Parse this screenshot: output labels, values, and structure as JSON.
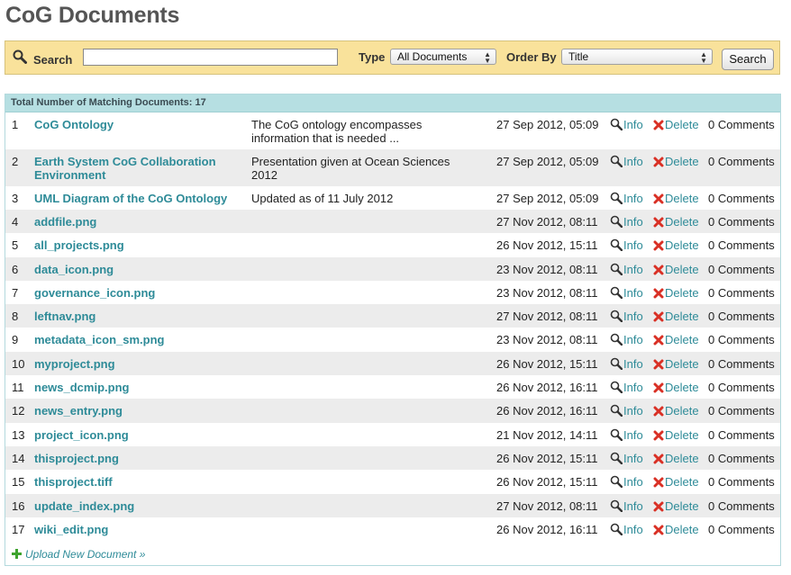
{
  "page": {
    "title": "CoG Documents"
  },
  "search": {
    "label": "Search",
    "value": "",
    "type_label": "Type",
    "type_selected": "All Documents",
    "order_label": "Order By",
    "order_selected": "Title",
    "button_label": "Search"
  },
  "results": {
    "summary": "Total Number of Matching Documents: 17",
    "rows": [
      {
        "num": "1",
        "title": [
          "CoG Ontology"
        ],
        "desc": [
          "The CoG ontology encompasses",
          "information that is needed ..."
        ],
        "date": "27 Sep 2012, 05:09",
        "info": "Info",
        "delete": "Delete",
        "comments": "0 Comments"
      },
      {
        "num": "2",
        "title": [
          "Earth System CoG Collaboration",
          "Environment"
        ],
        "desc": [
          "Presentation given at Ocean Sciences",
          "2012"
        ],
        "date": "27 Sep 2012, 05:09",
        "info": "Info",
        "delete": "Delete",
        "comments": "0 Comments"
      },
      {
        "num": "3",
        "title": [
          "UML Diagram of the CoG Ontology"
        ],
        "desc": [
          "Updated as of 11 July 2012"
        ],
        "date": "27 Sep 2012, 05:09",
        "info": "Info",
        "delete": "Delete",
        "comments": "0 Comments"
      },
      {
        "num": "4",
        "title": [
          "addfile.png"
        ],
        "desc": [],
        "date": "27 Nov 2012, 08:11",
        "info": "Info",
        "delete": "Delete",
        "comments": "0 Comments"
      },
      {
        "num": "5",
        "title": [
          "all_projects.png"
        ],
        "desc": [],
        "date": "26 Nov 2012, 15:11",
        "info": "Info",
        "delete": "Delete",
        "comments": "0 Comments"
      },
      {
        "num": "6",
        "title": [
          "data_icon.png"
        ],
        "desc": [],
        "date": "23 Nov 2012, 08:11",
        "info": "Info",
        "delete": "Delete",
        "comments": "0 Comments"
      },
      {
        "num": "7",
        "title": [
          "governance_icon.png"
        ],
        "desc": [],
        "date": "23 Nov 2012, 08:11",
        "info": "Info",
        "delete": "Delete",
        "comments": "0 Comments"
      },
      {
        "num": "8",
        "title": [
          "leftnav.png"
        ],
        "desc": [],
        "date": "27 Nov 2012, 08:11",
        "info": "Info",
        "delete": "Delete",
        "comments": "0 Comments"
      },
      {
        "num": "9",
        "title": [
          "metadata_icon_sm.png"
        ],
        "desc": [],
        "date": "23 Nov 2012, 08:11",
        "info": "Info",
        "delete": "Delete",
        "comments": "0 Comments"
      },
      {
        "num": "10",
        "title": [
          "myproject.png"
        ],
        "desc": [],
        "date": "26 Nov 2012, 15:11",
        "info": "Info",
        "delete": "Delete",
        "comments": "0 Comments"
      },
      {
        "num": "11",
        "title": [
          "news_dcmip.png"
        ],
        "desc": [],
        "date": "26 Nov 2012, 16:11",
        "info": "Info",
        "delete": "Delete",
        "comments": "0 Comments"
      },
      {
        "num": "12",
        "title": [
          "news_entry.png"
        ],
        "desc": [],
        "date": "26 Nov 2012, 16:11",
        "info": "Info",
        "delete": "Delete",
        "comments": "0 Comments"
      },
      {
        "num": "13",
        "title": [
          "project_icon.png"
        ],
        "desc": [],
        "date": "21 Nov 2012, 14:11",
        "info": "Info",
        "delete": "Delete",
        "comments": "0 Comments"
      },
      {
        "num": "14",
        "title": [
          "thisproject.png"
        ],
        "desc": [],
        "date": "26 Nov 2012, 15:11",
        "info": "Info",
        "delete": "Delete",
        "comments": "0 Comments"
      },
      {
        "num": "15",
        "title": [
          "thisproject.tiff"
        ],
        "desc": [],
        "date": "26 Nov 2012, 15:11",
        "info": "Info",
        "delete": "Delete",
        "comments": "0 Comments"
      },
      {
        "num": "16",
        "title": [
          "update_index.png"
        ],
        "desc": [],
        "date": "27 Nov 2012, 08:11",
        "info": "Info",
        "delete": "Delete",
        "comments": "0 Comments"
      },
      {
        "num": "17",
        "title": [
          "wiki_edit.png"
        ],
        "desc": [],
        "date": "26 Nov 2012, 16:11",
        "info": "Info",
        "delete": "Delete",
        "comments": "0 Comments"
      }
    ],
    "upload_link": "Upload New Document »"
  },
  "colors": {
    "link": "#2e8b98",
    "searchbar": "#f9e29b",
    "header": "#b6dfe2",
    "alt_row": "#ececec",
    "delete_icon": "#d93025"
  },
  "icons": {
    "search": "magnifier-icon",
    "info": "magnifier-icon",
    "delete": "red-x-icon",
    "upload": "green-plus-icon"
  }
}
